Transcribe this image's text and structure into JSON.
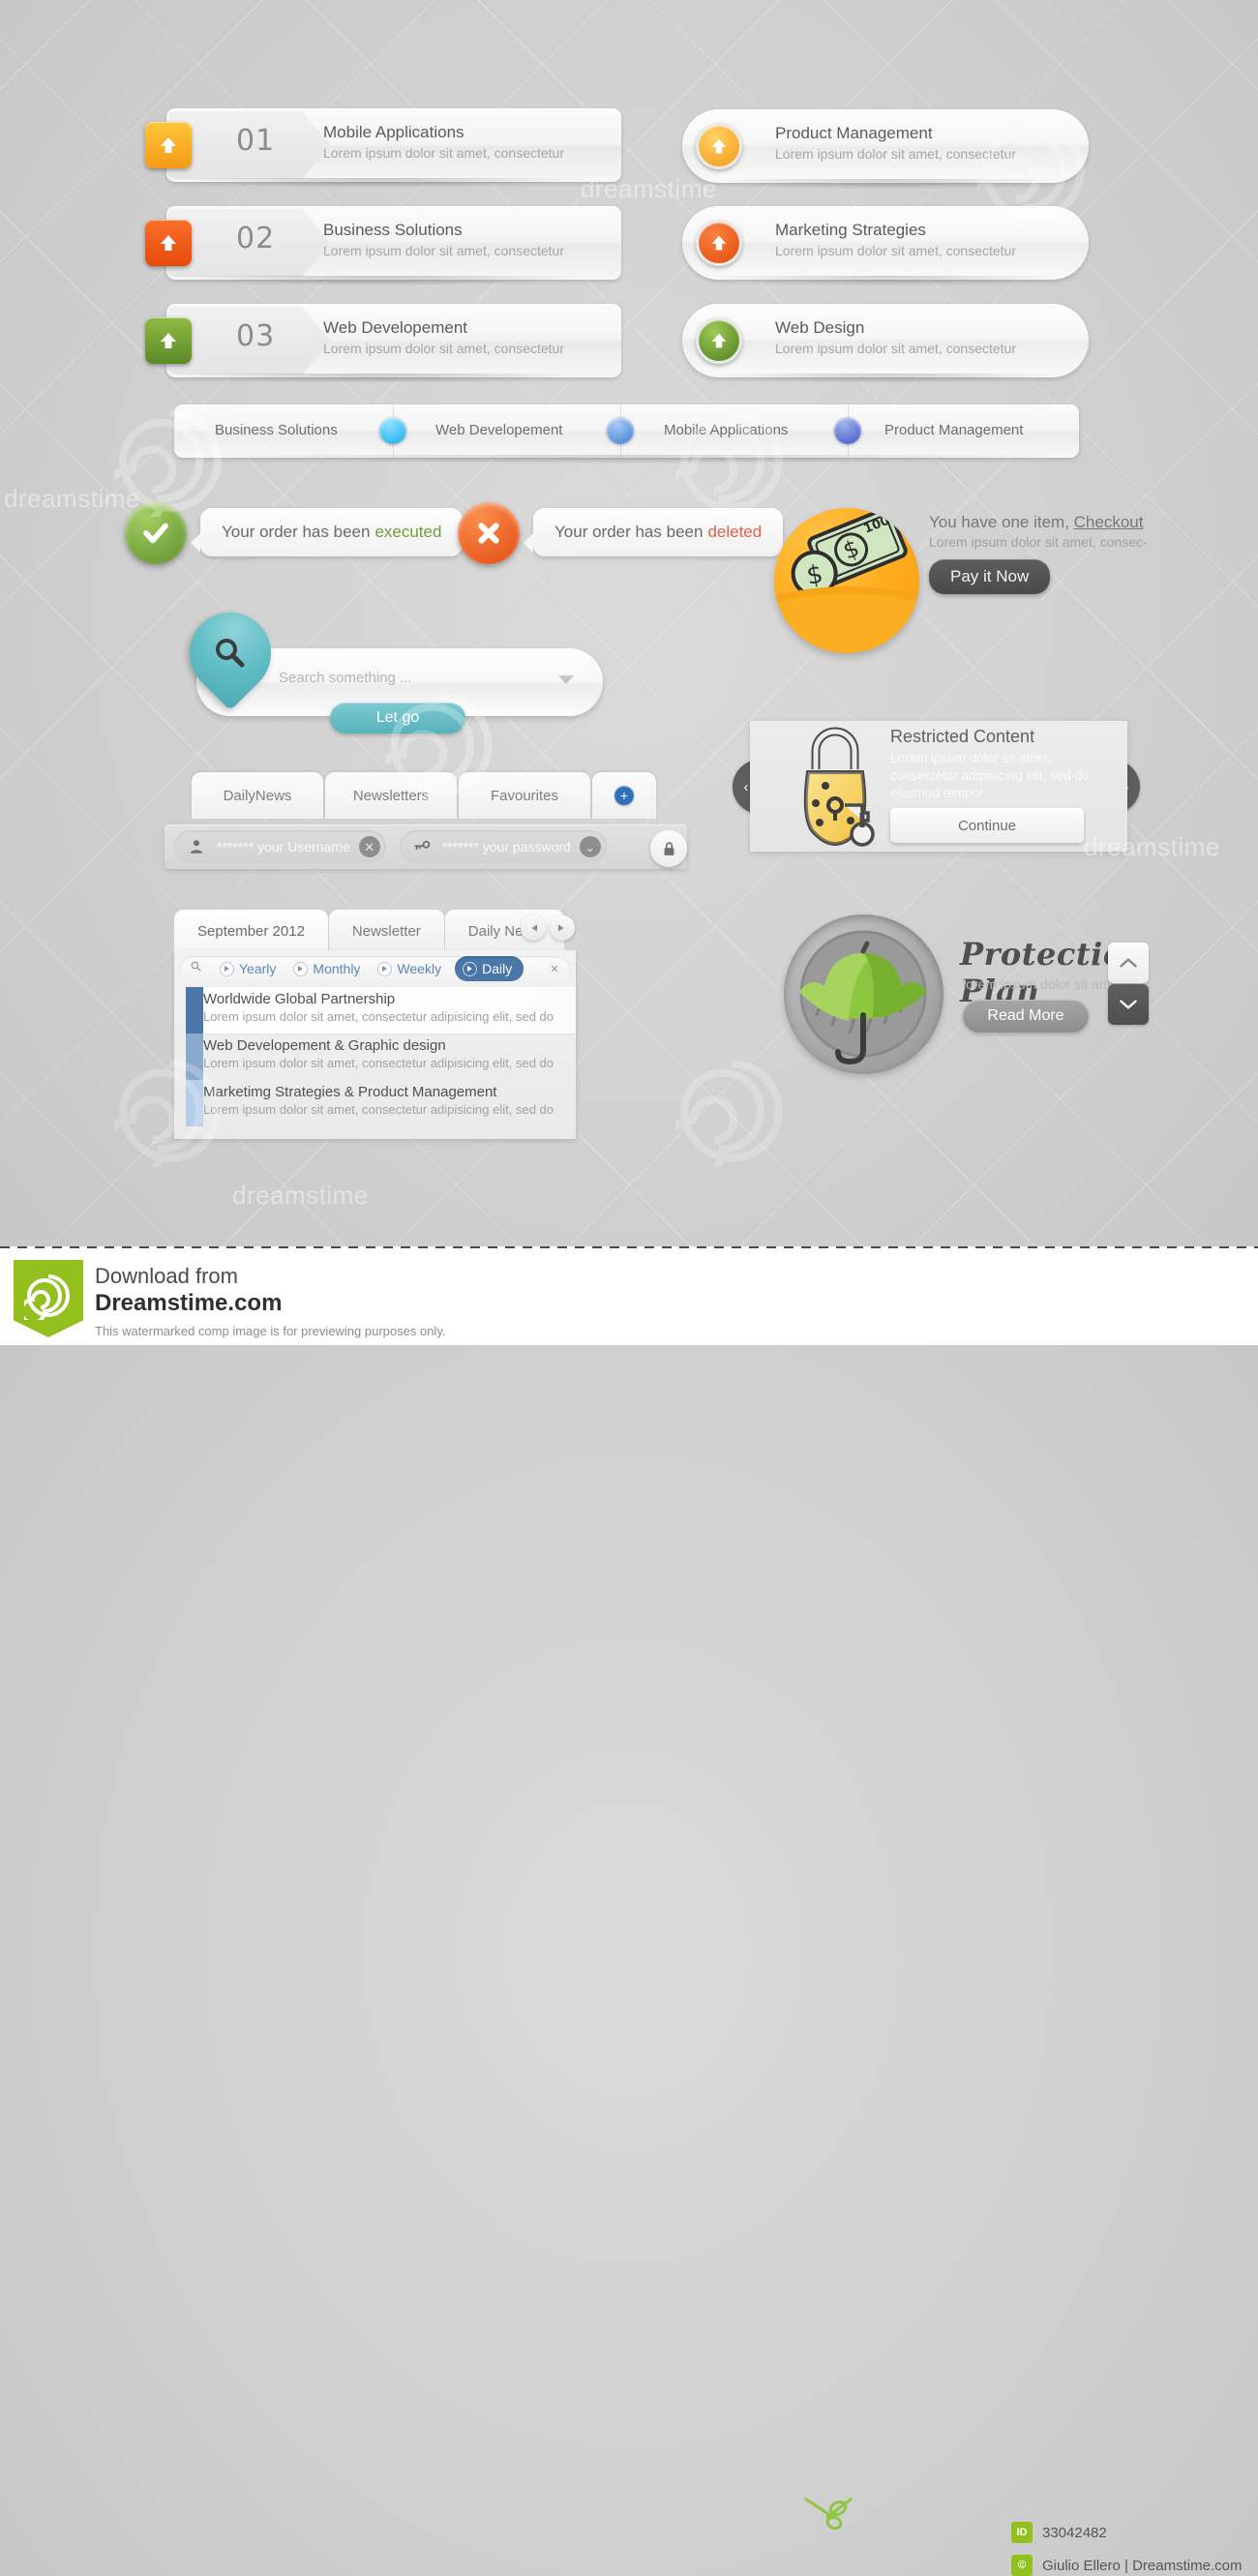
{
  "colors": {
    "bg": "#d2d2d2",
    "orange_light": "#f9a81c",
    "orange_dark": "#ee5b13",
    "green": "#6ba238",
    "blue_accent": "#2f72bb",
    "teal": "#62bec6",
    "filter_active": "#4a76a8",
    "success_green": "#6f9e36",
    "error_orange": "#e8601c",
    "dreamstime_green": "#93c01f"
  },
  "numbered_items": [
    {
      "number": "01",
      "title": "Mobile Applications",
      "subtitle": "Lorem ipsum dolor sit amet, consectetur",
      "icon": "arrow-up-icon",
      "color_a": "#ffc63a",
      "color_b": "#f59a17"
    },
    {
      "number": "02",
      "title": "Business Solutions",
      "subtitle": "Lorem ipsum dolor sit amet, consectetur",
      "icon": "arrow-up-icon",
      "color_a": "#f8702a",
      "color_b": "#e84a0c"
    },
    {
      "number": "03",
      "title": "Web Developement",
      "subtitle": "Lorem ipsum dolor sit amet, consectetur",
      "icon": "arrow-up-icon",
      "color_a": "#8fbb43",
      "color_b": "#5d8a27"
    }
  ],
  "pill_items": [
    {
      "title": "Product Management",
      "subtitle": "Lorem ipsum dolor sit amet, consectetur",
      "icon": "arrow-up-icon",
      "color_a": "#ffc63a",
      "color_b": "#f59a17"
    },
    {
      "title": "Marketing Strategies",
      "subtitle": "Lorem ipsum dolor sit amet, consectetur",
      "icon": "arrow-up-icon",
      "color_a": "#f8702a",
      "color_b": "#e84a0c"
    },
    {
      "title": "Web Design",
      "subtitle": "Lorem ipsum dolor sit amet, consectetur",
      "icon": "arrow-up-icon",
      "color_a": "#8fbb43",
      "color_b": "#5d8a27"
    }
  ],
  "breadcrumb": {
    "items": [
      {
        "label": "Business Solutions"
      },
      {
        "label": "Web Developement"
      },
      {
        "label": "Mobile Applications"
      },
      {
        "label": "Product Management"
      }
    ],
    "dot_colors": [
      "#29b6f0",
      "#4a90e2",
      "#5566cc"
    ]
  },
  "notifications": [
    {
      "icon": "check-icon",
      "text_prefix": "Your order has been",
      "highlight": "executed",
      "badge_a": "#8cbb4b",
      "badge_b": "#5d8f2a",
      "hl_color": "#6f9e36"
    },
    {
      "icon": "close-icon",
      "text_prefix": "Your order has been",
      "highlight": "deleted",
      "badge_a": "#f8762c",
      "badge_b": "#e2490e",
      "hl_color": "#e8604a"
    }
  ],
  "checkout": {
    "icon": "money-icon",
    "line1_text": "You have one item, ",
    "line1_link": "Checkout",
    "line2": "Lorem ipsum dolor sit amet, consec-",
    "button": "Pay it Now"
  },
  "search": {
    "icon": "search-pin-icon",
    "placeholder": "Search something ...",
    "dropdown_icon": "chevron-down-icon",
    "button": "Let go"
  },
  "tabs": {
    "items": [
      "DailyNews",
      "Newsletters",
      "Favourites"
    ],
    "add_icon": "plus-icon"
  },
  "login": {
    "username": {
      "icon": "user-icon",
      "mask": "*******",
      "value": "your Username",
      "action_icon": "close-icon"
    },
    "password": {
      "icon": "key-icon",
      "mask": "*******",
      "value": "your password",
      "action_icon": "chevron-down-icon"
    },
    "submit_icon": "lock-icon"
  },
  "news": {
    "tabs": [
      {
        "label": "September 2012",
        "active": true
      },
      {
        "label": "Newsletter",
        "active": false
      },
      {
        "label": "Daily News",
        "active": false
      }
    ],
    "nav_prev_icon": "skip-back-icon",
    "nav_next_icon": "skip-forward-icon",
    "filters": {
      "search_icon": "search-icon",
      "options": [
        {
          "label": "Yearly",
          "active": false
        },
        {
          "label": "Monthly",
          "active": false
        },
        {
          "label": "Weekly",
          "active": false
        },
        {
          "label": "Daily",
          "active": true
        }
      ],
      "close_icon": "close-icon"
    },
    "items": [
      {
        "title": "Worldwide Global Partnership",
        "subtitle": "Lorem ipsum dolor sit amet, consectetur adipisicing elit, sed do",
        "bar_color": "#4a76a8",
        "selected": true
      },
      {
        "title": "Web Developement & Graphic design",
        "subtitle": "Lorem ipsum dolor sit amet, consectetur adipisicing elit, sed do",
        "bar_color": "#8aa9cd",
        "selected": false
      },
      {
        "title": "Marketimg Strategies & Product Management",
        "subtitle": "Lorem ipsum dolor sit amet, consectetur adipisicing elit, sed do",
        "bar_color": "#b6cdea",
        "selected": false
      }
    ]
  },
  "restricted": {
    "icon": "padlock-icon",
    "title": "Restricted Content",
    "body": "Lorem ipsum dolor sit amet, consectetur adipisicing elit, sed do eiusmod tempor",
    "button": "Continue",
    "prev_icon": "chevron-left-icon",
    "next_icon": "chevron-right-icon"
  },
  "protection": {
    "icon": "umbrella-icon",
    "title": "Protection Plan",
    "subtitle": "lorem ipsum dolor sit amet",
    "button": "Read More",
    "up_icon": "chevron-up-icon",
    "down_icon": "chevron-down-icon"
  },
  "watermark": {
    "brand": "dreamstime",
    "footer_line1": "Download from",
    "footer_line2": "Dreamstime.com",
    "footer_line3": "This watermarked comp image is for previewing purposes only.",
    "id_label": "ID",
    "id_value": "33042482",
    "copyright_label": "C",
    "copyright_value": "Giulio Ellero | Dreamstime.com"
  }
}
